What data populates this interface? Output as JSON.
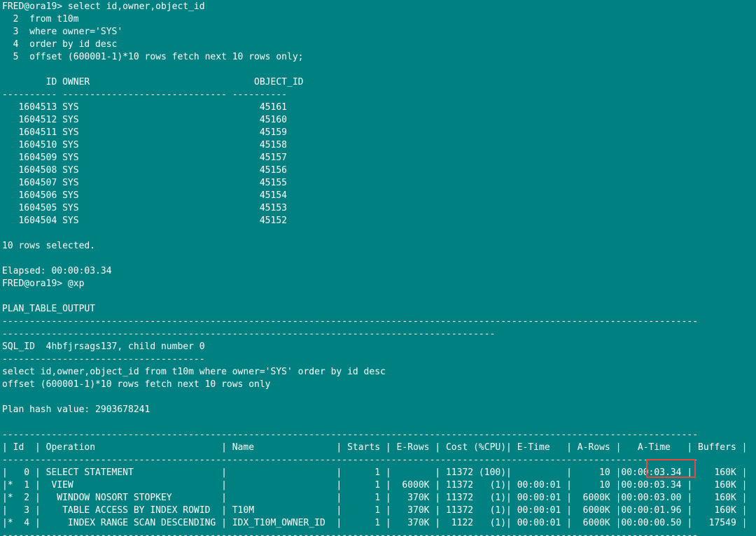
{
  "terminal": {
    "lines": [
      "FRED@ora19> select id,owner,object_id",
      "  2  from t10m",
      "  3  where owner='SYS'",
      "  4  order by id desc",
      "  5  offset (600001-1)*10 rows fetch next 10 rows only;",
      "",
      "        ID OWNER                              OBJECT_ID",
      "---------- ------------------------------ ----------",
      "   1604513 SYS                                 45161",
      "   1604512 SYS                                 45160",
      "   1604511 SYS                                 45159",
      "   1604510 SYS                                 45158",
      "   1604509 SYS                                 45157",
      "   1604508 SYS                                 45156",
      "   1604507 SYS                                 45155",
      "   1604506 SYS                                 45154",
      "   1604505 SYS                                 45153",
      "   1604504 SYS                                 45152",
      "",
      "10 rows selected.",
      "",
      "Elapsed: 00:00:03.34",
      "FRED@ora19> @xp",
      "",
      "PLAN_TABLE_OUTPUT",
      "-------------------------------------------------------------------------------------------------------------------------------",
      "------------------------------------------------------------------------------------------",
      "SQL_ID  4hbfjrsags137, child number 0",
      "-------------------------------------",
      "select id,owner,object_id from t10m where owner='SYS' order by id desc",
      "offset (600001-1)*10 rows fetch next 10 rows only",
      "",
      "Plan hash value: 2903678241",
      "",
      "-------------------------------------------------------------------------------------------------------------------------------",
      "| Id  | Operation                       | Name               | Starts | E-Rows | Cost (%CPU)| E-Time   | A-Rows |   A-Time   | Buffers |",
      "-------------------------------------------------------------------------------------------------------------------------------",
      "|   0 | SELECT STATEMENT                |                    |      1 |        | 11372 (100)|          |     10 |00:00:03.34 |    160K |",
      "|*  1 |  VIEW                           |                    |      1 |  6000K | 11372   (1)| 00:00:01 |     10 |00:00:03.34 |    160K |",
      "|*  2 |   WINDOW NOSORT STOPKEY         |                    |      1 |   370K | 11372   (1)| 00:00:01 |  6000K |00:00:03.00 |    160K |",
      "|   3 |    TABLE ACCESS BY INDEX ROWID  | T10M               |      1 |   370K | 11372   (1)| 00:00:01 |  6000K |00:00:01.96 |    160K |",
      "|*  4 |     INDEX RANGE SCAN DESCENDING | IDX_T10M_OWNER_ID  |      1 |   370K |  1122   (1)| 00:00:01 |  6000K |00:00:00.50 |   17549 |",
      "-------------------------------------------------------------------------------------------------------------------------------"
    ]
  }
}
